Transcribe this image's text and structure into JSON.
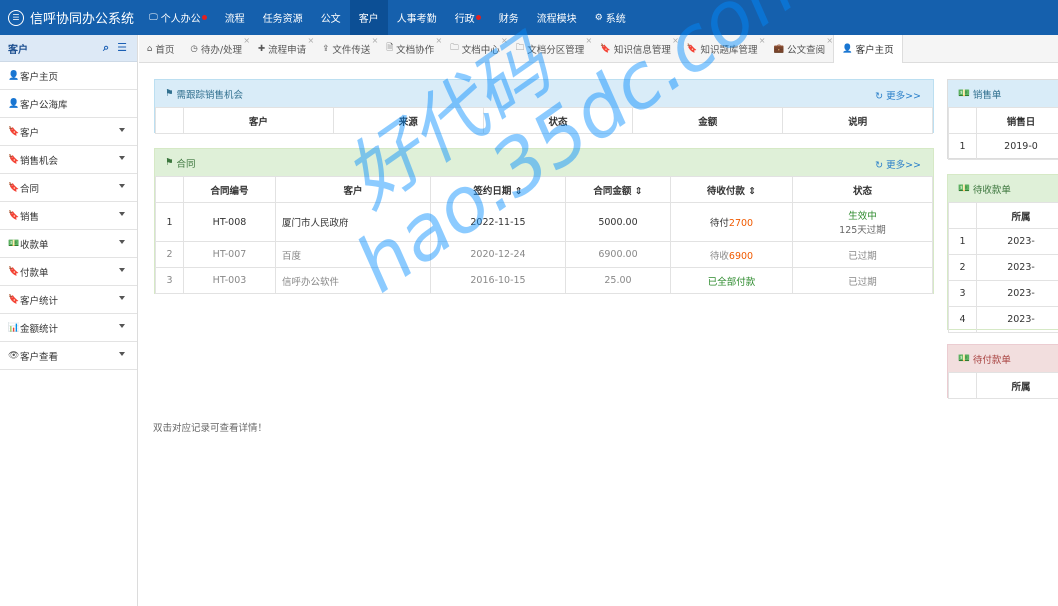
{
  "app": {
    "title": "信呼协同办公系统"
  },
  "nav": [
    {
      "label": "个人办公",
      "icon": "monitor-icon",
      "dot": true,
      "active": false
    },
    {
      "label": "流程",
      "dot": false,
      "active": false
    },
    {
      "label": "任务资源",
      "dot": false,
      "active": false
    },
    {
      "label": "公文",
      "dot": false,
      "active": false
    },
    {
      "label": "客户",
      "dot": false,
      "active": true
    },
    {
      "label": "人事考勤",
      "dot": false,
      "active": false
    },
    {
      "label": "行政",
      "dot": true,
      "active": false
    },
    {
      "label": "财务",
      "dot": false,
      "active": false
    },
    {
      "label": "流程模块",
      "dot": false,
      "active": false
    },
    {
      "label": "系统",
      "icon": "gear-icon",
      "dot": false,
      "active": false
    }
  ],
  "sidebar": {
    "title": "客户",
    "items": [
      {
        "label": "客户主页",
        "icon": "user-icon",
        "caret": false
      },
      {
        "label": "客户公海库",
        "icon": "user-icon",
        "caret": false
      },
      {
        "label": "客户",
        "icon": "bookmark-icon",
        "caret": true
      },
      {
        "label": "销售机会",
        "icon": "bookmark-icon",
        "caret": true
      },
      {
        "label": "合同",
        "icon": "bookmark-icon",
        "caret": true
      },
      {
        "label": "销售",
        "icon": "bookmark-icon",
        "caret": true
      },
      {
        "label": "收款单",
        "icon": "money-icon",
        "caret": true
      },
      {
        "label": "付款单",
        "icon": "bookmark-icon",
        "caret": true
      },
      {
        "label": "客户统计",
        "icon": "bookmark-icon",
        "caret": true
      },
      {
        "label": "金额统计",
        "icon": "bar-chart-icon",
        "caret": true
      },
      {
        "label": "客户查看",
        "icon": "eye-icon",
        "caret": true
      }
    ]
  },
  "tabs": [
    {
      "label": "首页",
      "icon": "home-icon",
      "active": false,
      "close": false
    },
    {
      "label": "待办/处理",
      "icon": "clock-icon",
      "active": false,
      "close": true
    },
    {
      "label": "流程申请",
      "icon": "plus-icon",
      "active": false,
      "close": true
    },
    {
      "label": "文件传送",
      "icon": "share-icon",
      "active": false,
      "close": true
    },
    {
      "label": "文档协作",
      "icon": "file-icon",
      "active": false,
      "close": true
    },
    {
      "label": "文档中心",
      "icon": "folder-icon",
      "active": false,
      "close": true
    },
    {
      "label": "文档分区管理",
      "icon": "folder-icon",
      "active": false,
      "close": true
    },
    {
      "label": "知识信息管理",
      "icon": "bookmark-icon",
      "active": false,
      "close": true
    },
    {
      "label": "知识题库管理",
      "icon": "bookmark-icon",
      "active": false,
      "close": true
    },
    {
      "label": "公文查阅",
      "icon": "briefcase-icon",
      "active": false,
      "close": true
    },
    {
      "label": "客户主页",
      "icon": "user-icon",
      "active": true,
      "close": false
    }
  ],
  "opportunity": {
    "title": "需跟踪销售机会",
    "more": "更多>>",
    "headers": [
      "客户",
      "来源",
      "状态",
      "金额",
      "说明"
    ]
  },
  "contract": {
    "title": "合同",
    "more": "更多>>",
    "headers": [
      "合同编号",
      "客户",
      "签约日期 ⇕",
      "合同金额 ⇕",
      "待收付款 ⇕",
      "状态"
    ],
    "rows": [
      {
        "idx": "1",
        "no": "HT-008",
        "customer": "厦门市人民政府",
        "date": "2022-11-15",
        "amount": "5000.00",
        "pending_prefix": "待付",
        "pending_value": "2700",
        "status": "生效中",
        "status_sub": "125天过期",
        "grey": false
      },
      {
        "idx": "2",
        "no": "HT-007",
        "customer": "百度",
        "date": "2020-12-24",
        "amount": "6900.00",
        "pending_prefix": "待收",
        "pending_value": "6900",
        "status": "已过期",
        "status_sub": "",
        "grey": true
      },
      {
        "idx": "3",
        "no": "HT-003",
        "customer": "信呼办公软件",
        "date": "2016-10-15",
        "amount": "25.00",
        "pending_prefix": "",
        "pending_value": "已全部付款",
        "status": "已过期",
        "status_sub": "",
        "grey": true
      }
    ]
  },
  "note": "双击对应记录可查看详情！",
  "sales": {
    "title": "销售单",
    "header": "销售日",
    "rows": [
      {
        "idx": "1",
        "val": "2019-0"
      }
    ]
  },
  "receivable": {
    "title": "待收款单",
    "header": "所属",
    "rows": [
      {
        "idx": "1",
        "val": "2023-"
      },
      {
        "idx": "2",
        "val": "2023-"
      },
      {
        "idx": "3",
        "val": "2023-"
      },
      {
        "idx": "4",
        "val": "2023-"
      }
    ]
  },
  "payable": {
    "title": "待付款单",
    "header": "所属"
  },
  "watermark": {
    "line1": "好代码",
    "line2": "hao.35dc.com"
  }
}
